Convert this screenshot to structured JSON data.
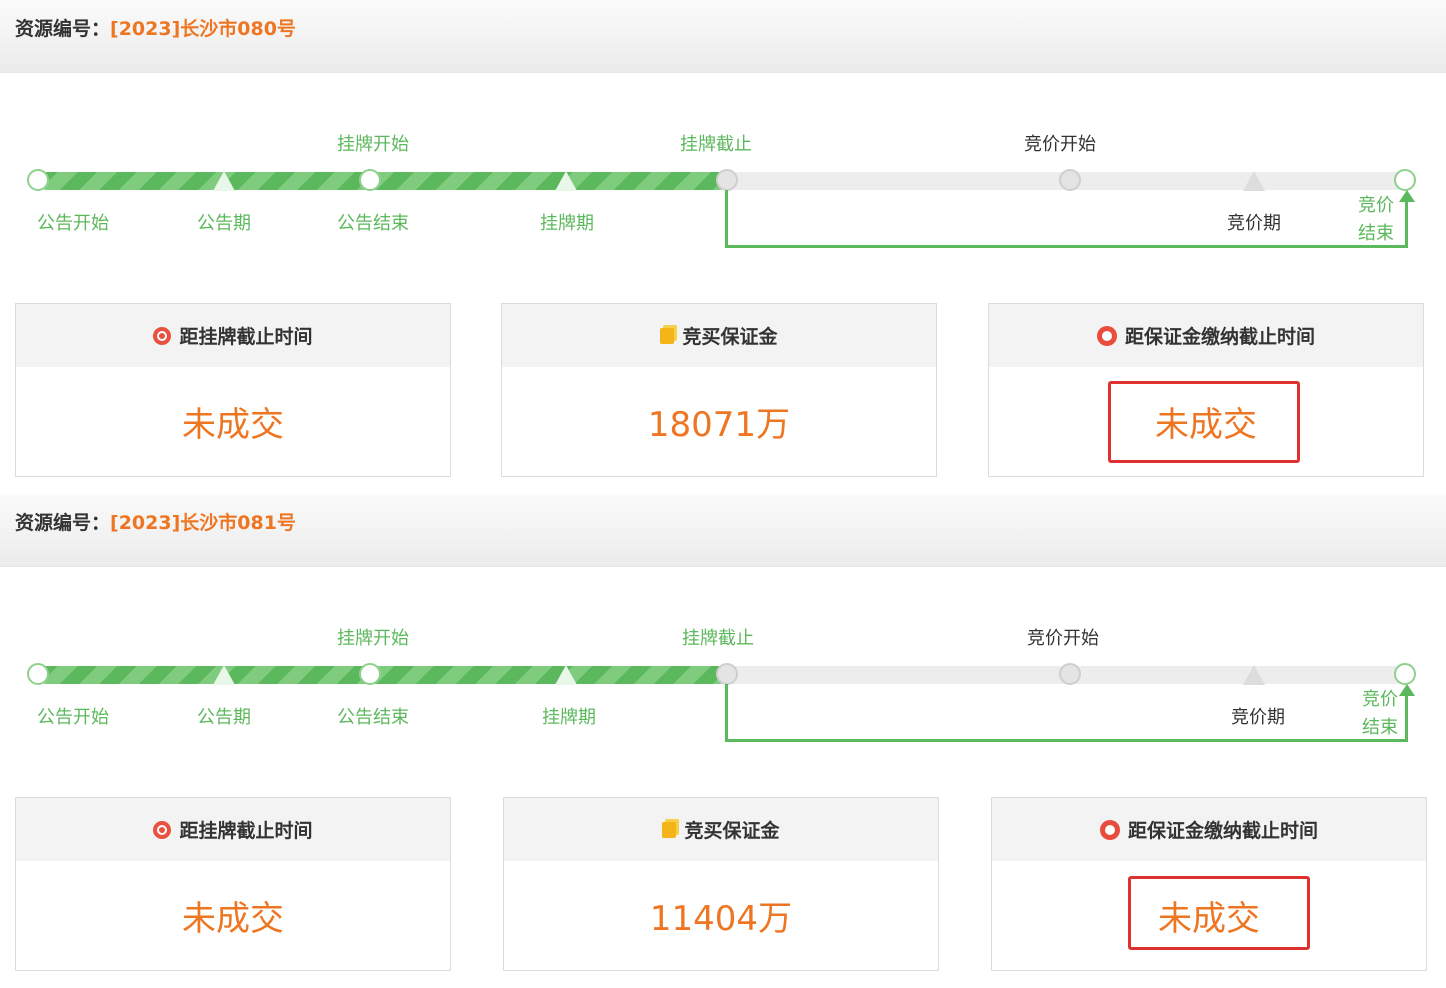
{
  "blocks": [
    {
      "resource_label": "资源编号：",
      "resource_code": "[2023]长沙市080号",
      "timeline": {
        "top_labels": [
          "挂牌开始",
          "挂牌截止",
          "竞价开始"
        ],
        "bottom_labels": [
          "公告开始",
          "公告期",
          "公告结束",
          "挂牌期"
        ],
        "bid_period": "竞价期",
        "bid_end": "竞价结束"
      },
      "cards": [
        {
          "title": "距挂牌截止时间",
          "value": "未成交",
          "icon": "alarm-clock-icon"
        },
        {
          "title": "竞买保证金",
          "value": "18071万",
          "icon": "coins-icon"
        },
        {
          "title": "距保证金缴纳截止时间",
          "value": "未成交",
          "icon": "timer-icon"
        }
      ]
    },
    {
      "resource_label": "资源编号：",
      "resource_code": "[2023]长沙市081号",
      "timeline": {
        "top_labels": [
          "挂牌开始",
          "挂牌截止",
          "竞价开始"
        ],
        "bottom_labels": [
          "公告开始",
          "公告期",
          "公告结束",
          "挂牌期"
        ],
        "bid_period": "竞价期",
        "bid_end": "竞价结束"
      },
      "cards": [
        {
          "title": "距挂牌截止时间",
          "value": "未成交",
          "icon": "alarm-clock-icon"
        },
        {
          "title": "竞买保证金",
          "value": "11404万",
          "icon": "coins-icon"
        },
        {
          "title": "距保证金缴纳截止时间",
          "value": "未成交",
          "icon": "timer-icon"
        }
      ]
    }
  ],
  "colors": {
    "accent_orange": "#ee7622",
    "progress_green": "#5cb85c",
    "highlight_red": "#e03131"
  }
}
